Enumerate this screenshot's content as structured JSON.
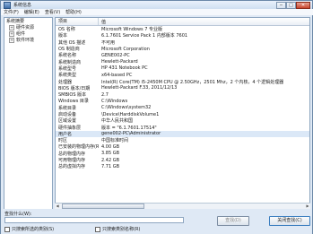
{
  "window": {
    "title": "系统信息",
    "controls": [
      "─",
      "□",
      "✕"
    ]
  },
  "menu": [
    "文件(F)",
    "编辑(E)",
    "查看(V)",
    "帮助(H)"
  ],
  "tree": {
    "root": "系统摘要",
    "children": [
      "硬件资源",
      "组件",
      "软件环境"
    ]
  },
  "table": {
    "headers": [
      "项目",
      "值"
    ],
    "rows": [
      [
        "OS 名称",
        "Microsoft Windows 7 专业版"
      ],
      [
        "版本",
        "6.1.7601 Service Pack 1 内部版本 7601"
      ],
      [
        "其他 OS 描述",
        "不可用"
      ],
      [
        "OS 制造商",
        "Microsoft Corporation"
      ],
      [
        "系统名称",
        "GENE002-PC"
      ],
      [
        "系统制造商",
        "Hewlett-Packard"
      ],
      [
        "系统型号",
        "HP 431 Notebook PC"
      ],
      [
        "系统类型",
        "x64-based PC"
      ],
      [
        "处理器",
        "Intel(R) Core(TM) i5-2450M CPU @ 2.50GHz，2501 Mhz，2 个内核，4 个逻辑处理器"
      ],
      [
        "BIOS 版本/日期",
        "Hewlett-Packard F.33, 2011/12/13"
      ],
      [
        "SMBIOS 版本",
        "2.7"
      ],
      [
        "Windows 目录",
        "C:\\Windows"
      ],
      [
        "系统目录",
        "C:\\Windows\\system32"
      ],
      [
        "启动设备",
        "\\Device\\HarddiskVolume1"
      ],
      [
        "区域设置",
        "中华人民共和国"
      ],
      [
        "硬件抽象层",
        "版本 = \"6.1.7601.17514\""
      ],
      [
        "用户名",
        "gene002-PC\\Administrator"
      ],
      [
        "时区",
        "中国标准时间"
      ],
      [
        "已安装的物理内存(RAM)",
        "4.00 GB"
      ],
      [
        "总的物理内存",
        "3.85 GB"
      ],
      [
        "可用物理内存",
        "2.42 GB"
      ],
      [
        "总的虚拟内存",
        "7.71 GB"
      ]
    ],
    "selected_row": 16
  },
  "bottom": {
    "find_label": "查找什么(W):",
    "find_value": "",
    "find_button": "查找(D)",
    "close_find_button": "关闭查找(C)",
    "checkbox_selected": "只搜索所选的类别(S)",
    "checkbox_names": "只搜索类别名称(R)"
  }
}
